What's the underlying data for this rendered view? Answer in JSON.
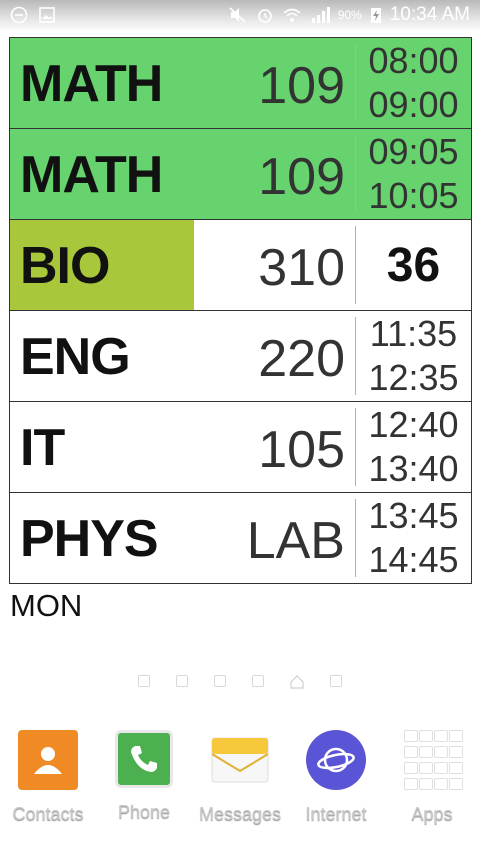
{
  "status_bar": {
    "battery": "90%",
    "time": "10:34 AM"
  },
  "schedule": {
    "rows": [
      {
        "subject": "MATH",
        "room": "109",
        "start": "08:00",
        "end": "09:00"
      },
      {
        "subject": "MATH",
        "room": "109",
        "start": "09:05",
        "end": "10:05"
      },
      {
        "subject": "BIO",
        "room": "310",
        "countdown": "36",
        "progress": 0.4
      },
      {
        "subject": "ENG",
        "room": "220",
        "start": "11:35",
        "end": "12:35"
      },
      {
        "subject": "IT",
        "room": "105",
        "start": "12:40",
        "end": "13:40"
      },
      {
        "subject": "PHYS",
        "room": "LAB",
        "start": "13:45",
        "end": "14:45"
      }
    ],
    "day": "MON",
    "colors": {
      "completed": "#66d36e",
      "progress": "#a9c73a"
    }
  },
  "dock": {
    "apps": [
      {
        "label": "Contacts",
        "icon": "contacts-icon"
      },
      {
        "label": "Phone",
        "icon": "phone-icon"
      },
      {
        "label": "Messages",
        "icon": "messages-icon"
      },
      {
        "label": "Internet",
        "icon": "internet-icon"
      },
      {
        "label": "Apps",
        "icon": "apps-grid-icon"
      }
    ]
  }
}
